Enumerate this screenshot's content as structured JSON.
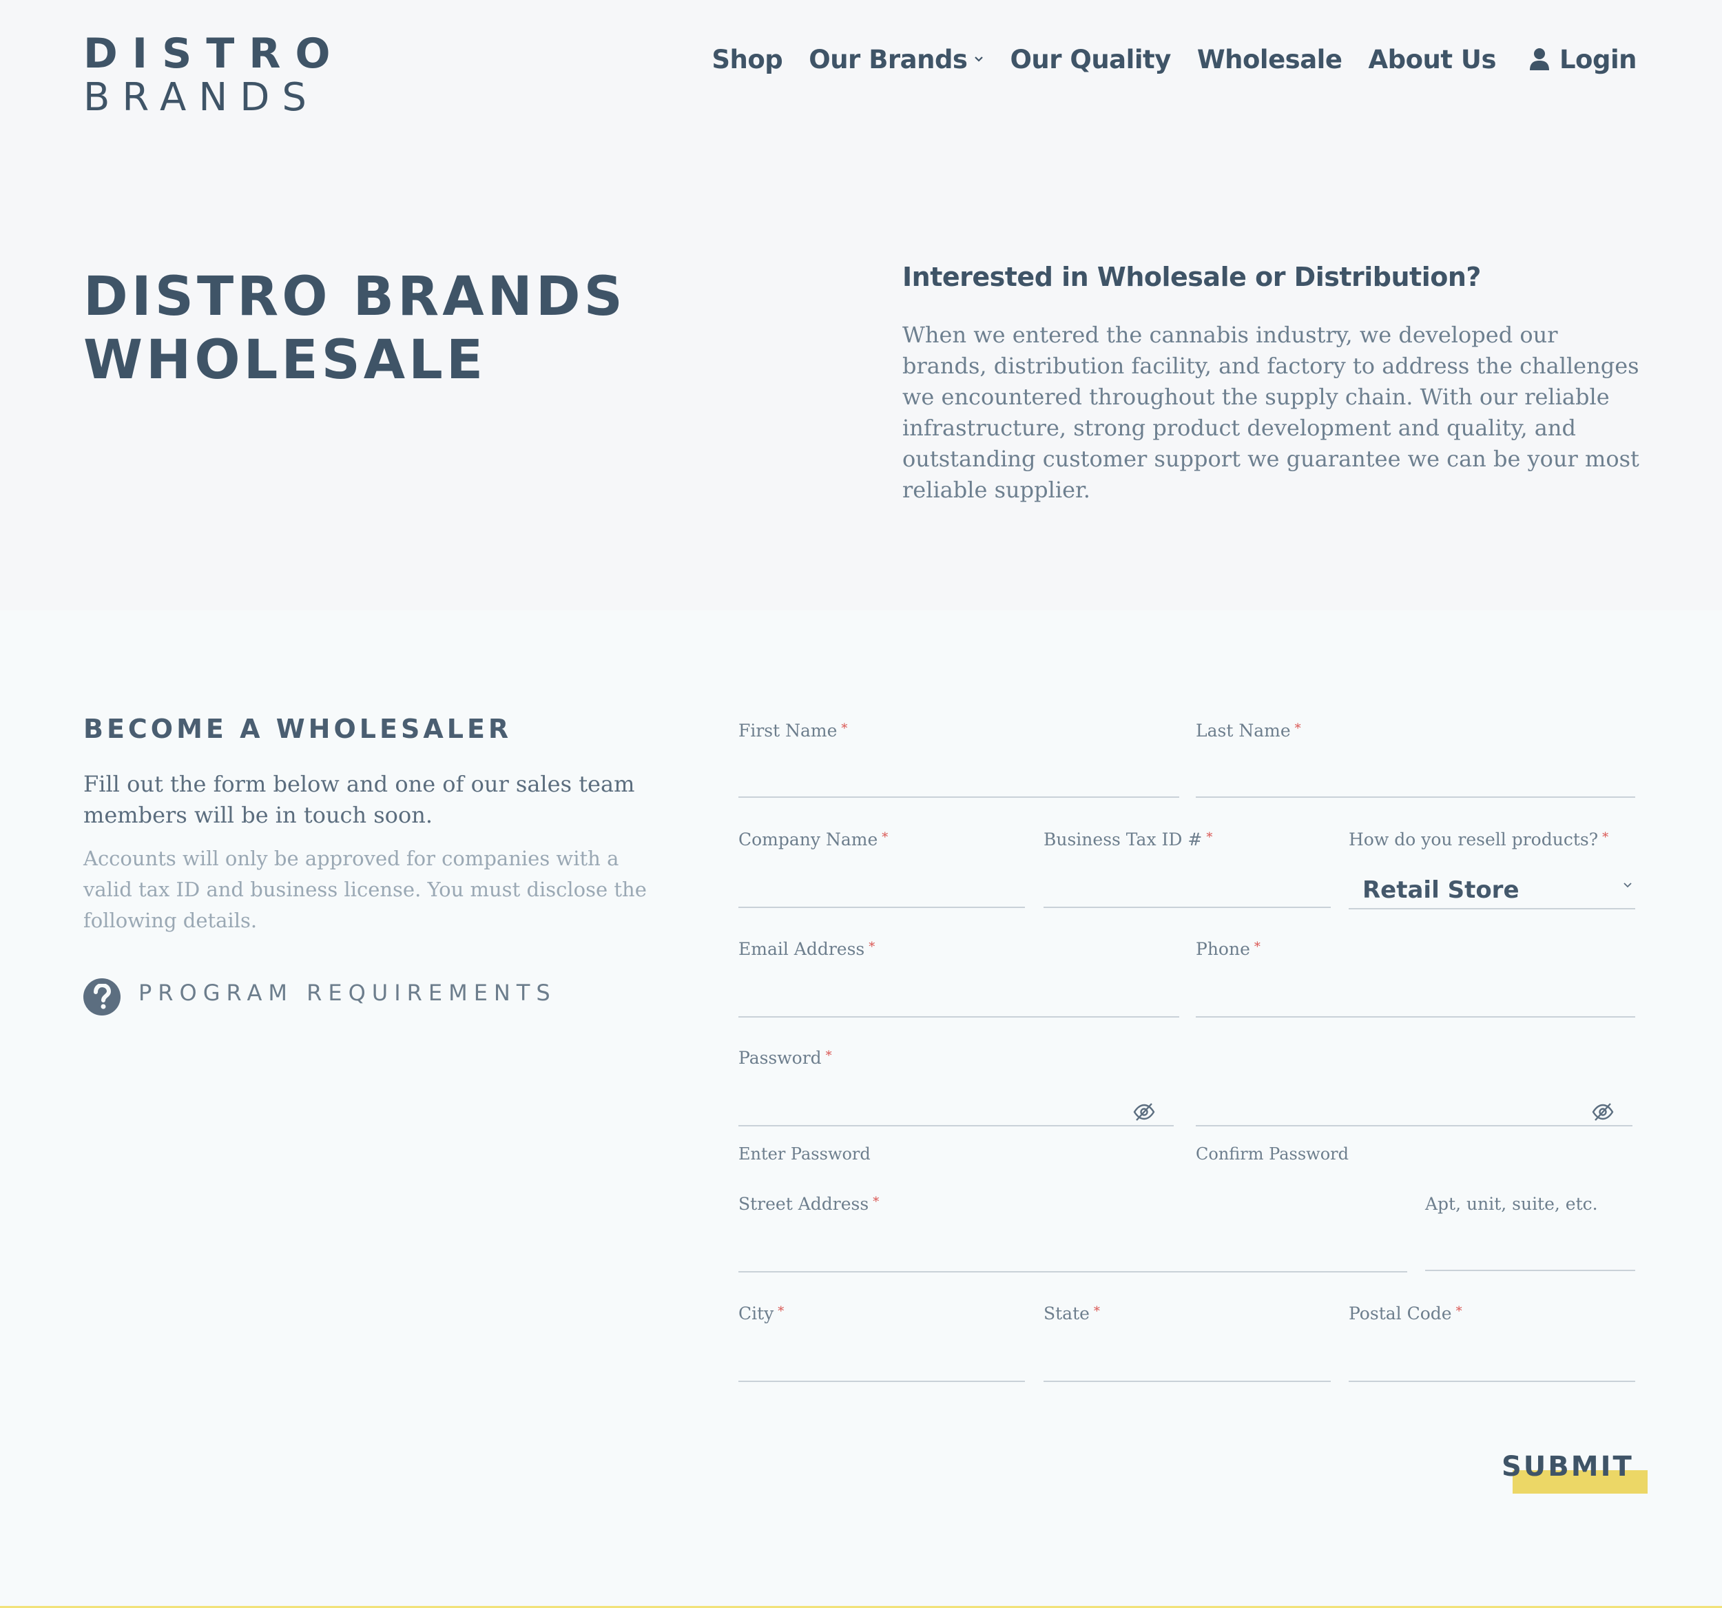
{
  "brand": {
    "line1": "DISTRO",
    "line2": "BRANDS"
  },
  "nav": {
    "items": [
      {
        "label": "Shop"
      },
      {
        "label": "Our Brands"
      },
      {
        "label": "Our Quality"
      },
      {
        "label": "Wholesale"
      },
      {
        "label": "About Us"
      }
    ],
    "login": "Login"
  },
  "hero": {
    "title_line1": "DISTRO BRANDS",
    "title_line2": "WHOLESALE",
    "subtitle": "Interested in Wholesale or Distribution?",
    "body": "When we entered the cannabis industry, we developed our brands, distribution facility, and factory to address the challenges we encountered throughout the supply chain. With our reliable infrastructure, strong product development and quality, and outstanding customer support we guarantee we can be your most reliable supplier."
  },
  "form_intro": {
    "title": "BECOME A WHOLESALER",
    "intro": "Fill out the form below and one of our sales team members will be in touch soon.",
    "note": "Accounts will only be approved for companies with a valid tax ID and business license. You must disclose the following details.",
    "requirements": "PROGRAM REQUIREMENTS"
  },
  "form": {
    "first_name": {
      "label": "First Name",
      "value": ""
    },
    "last_name": {
      "label": "Last Name",
      "value": ""
    },
    "company_name": {
      "label": "Company Name",
      "value": ""
    },
    "tax_id": {
      "label": "Business Tax ID #",
      "value": ""
    },
    "resell": {
      "label": "How do you resell products?",
      "value": "Retail Store"
    },
    "email": {
      "label": "Email Address",
      "value": ""
    },
    "phone": {
      "label": "Phone",
      "value": ""
    },
    "password": {
      "label": "Password",
      "enter_helper": "Enter Password",
      "confirm_helper": "Confirm Password"
    },
    "street": {
      "label": "Street Address",
      "value": ""
    },
    "apt": {
      "label": "Apt, unit, suite, etc.",
      "value": ""
    },
    "city": {
      "label": "City",
      "value": ""
    },
    "state": {
      "label": "State",
      "value": ""
    },
    "postal": {
      "label": "Postal Code",
      "value": ""
    },
    "required_mark": "*",
    "submit": "SUBMIT"
  },
  "colors": {
    "primary": "#3f5467",
    "accent_yellow": "#ecd766",
    "required_red": "#d9534f",
    "page_bg": "#f6f7f9",
    "section_bg": "#f7fafb"
  },
  "icons": {
    "login": "user-icon",
    "brands_dropdown": "chevron-down-icon",
    "requirements": "question-circle-icon",
    "password_toggle": "eye-off-icon"
  }
}
